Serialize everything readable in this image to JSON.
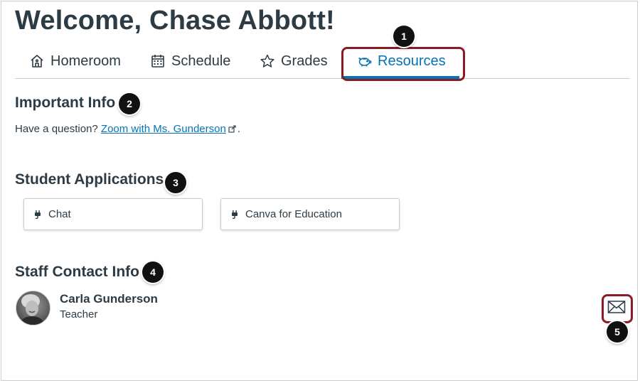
{
  "header": {
    "title": "Welcome, Chase Abbott!"
  },
  "tabs": [
    {
      "label": "Homeroom",
      "icon": "home-icon"
    },
    {
      "label": "Schedule",
      "icon": "calendar-icon"
    },
    {
      "label": "Grades",
      "icon": "star-icon"
    },
    {
      "label": "Resources",
      "icon": "piggy-bank-icon",
      "active": true
    }
  ],
  "important_info": {
    "title": "Important Info",
    "text_prefix": "Have a question? ",
    "link_text": "Zoom with Ms. Gunderson",
    "text_suffix": "."
  },
  "student_applications": {
    "title": "Student Applications",
    "apps": [
      {
        "label": "Chat",
        "icon": "plug-icon"
      },
      {
        "label": "Canva for Education",
        "icon": "plug-icon"
      }
    ]
  },
  "staff_contact": {
    "title": "Staff Contact Info",
    "name": "Carla Gunderson",
    "role": "Teacher",
    "action_icon": "envelope-icon"
  },
  "markers": [
    "1",
    "2",
    "3",
    "4",
    "5"
  ],
  "colors": {
    "accent": "#0374b5",
    "highlight": "#8b1c25",
    "text": "#2d3b45"
  }
}
